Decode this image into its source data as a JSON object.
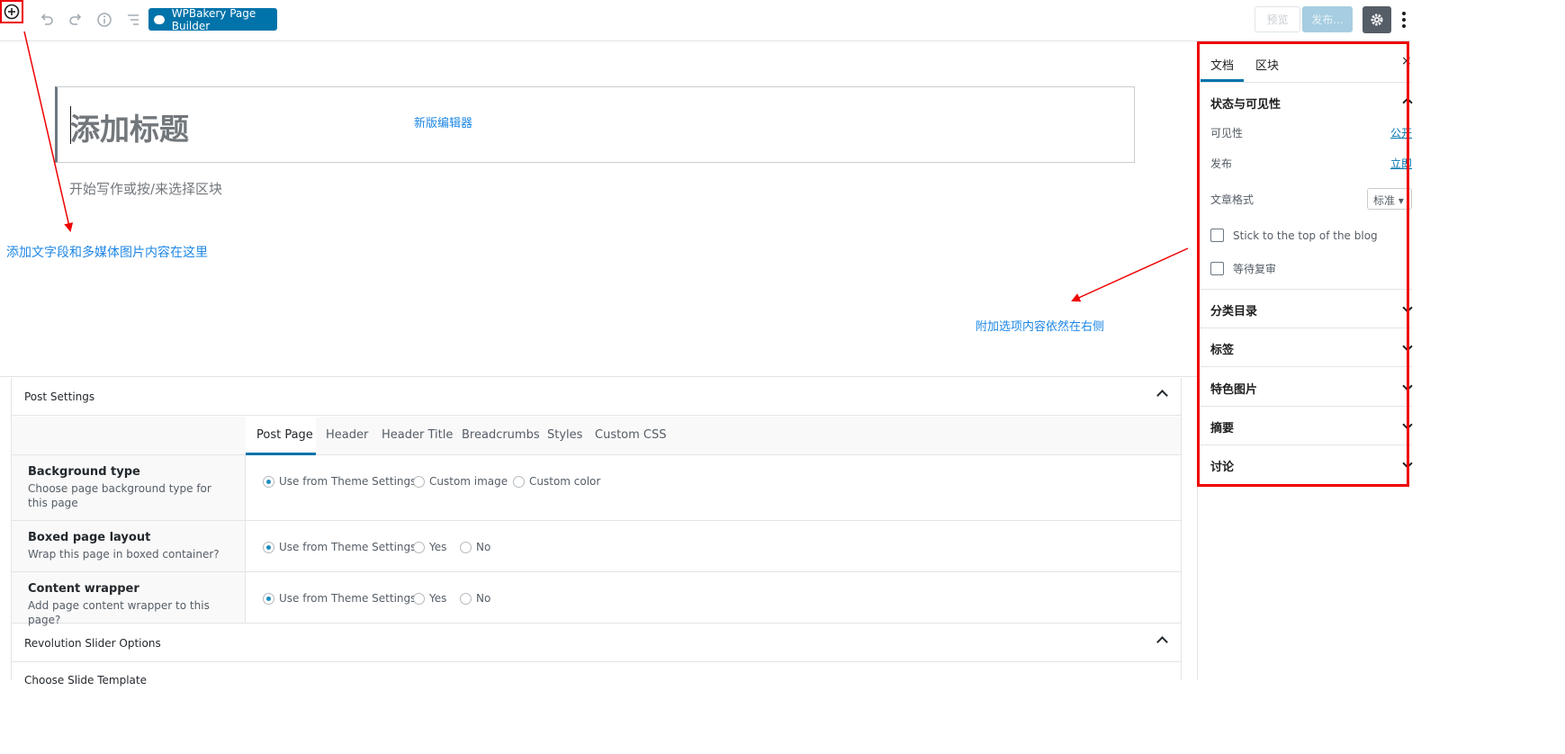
{
  "toolbar": {
    "wpbakery_label": "WPBakery Page Builder",
    "preview_label": "预览",
    "publish_label": "发布...",
    "icons": [
      "add-block-icon",
      "undo-icon",
      "redo-icon",
      "info-icon",
      "outline-icon",
      "wpbakery-cloud-icon",
      "gear-icon",
      "more-vertical-icon"
    ]
  },
  "editor": {
    "title_placeholder": "添加标题",
    "body_placeholder": "开始写作或按/来选择区块"
  },
  "annotations": {
    "new_editor": "新版编辑器",
    "add_content": "添加文字段和多媒体图片内容在这里",
    "right_side": "附加选项内容依然在右侧",
    "color": "#1e87e5"
  },
  "post_settings": {
    "title": "Post Settings",
    "tabs": [
      "Post Page",
      "Header",
      "Header Title",
      "Breadcrumbs",
      "Styles",
      "Custom CSS"
    ],
    "rows": [
      {
        "title": "Background type",
        "desc": "Choose page background type for this page",
        "options": [
          "Use from Theme Settings",
          "Custom image",
          "Custom color"
        ],
        "selected": 0
      },
      {
        "title": "Boxed page layout",
        "desc": "Wrap this page in boxed container?",
        "options": [
          "Use from Theme Settings",
          "Yes",
          "No"
        ],
        "selected": 0
      },
      {
        "title": "Content wrapper",
        "desc": "Add page content wrapper to this page?",
        "options": [
          "Use from Theme Settings",
          "Yes",
          "No"
        ],
        "selected": 0
      }
    ]
  },
  "revolution": {
    "title": "Revolution Slider Options",
    "sub_label": "Choose Slide Template"
  },
  "sidebar": {
    "tabs": [
      "文档",
      "区块"
    ],
    "close": "×",
    "status_panel": {
      "title": "状态与可见性",
      "visibility_label": "可见性",
      "visibility_value": "公开",
      "publish_label": "发布",
      "publish_value": "立即",
      "format_label": "文章格式",
      "format_value": "标准",
      "sticky_label": "Stick to the top of the blog",
      "pending_label": "等待复审"
    },
    "panels": [
      "分类目录",
      "标签",
      "特色图片",
      "摘要",
      "讨论"
    ],
    "highlight_color": "#e00000"
  }
}
